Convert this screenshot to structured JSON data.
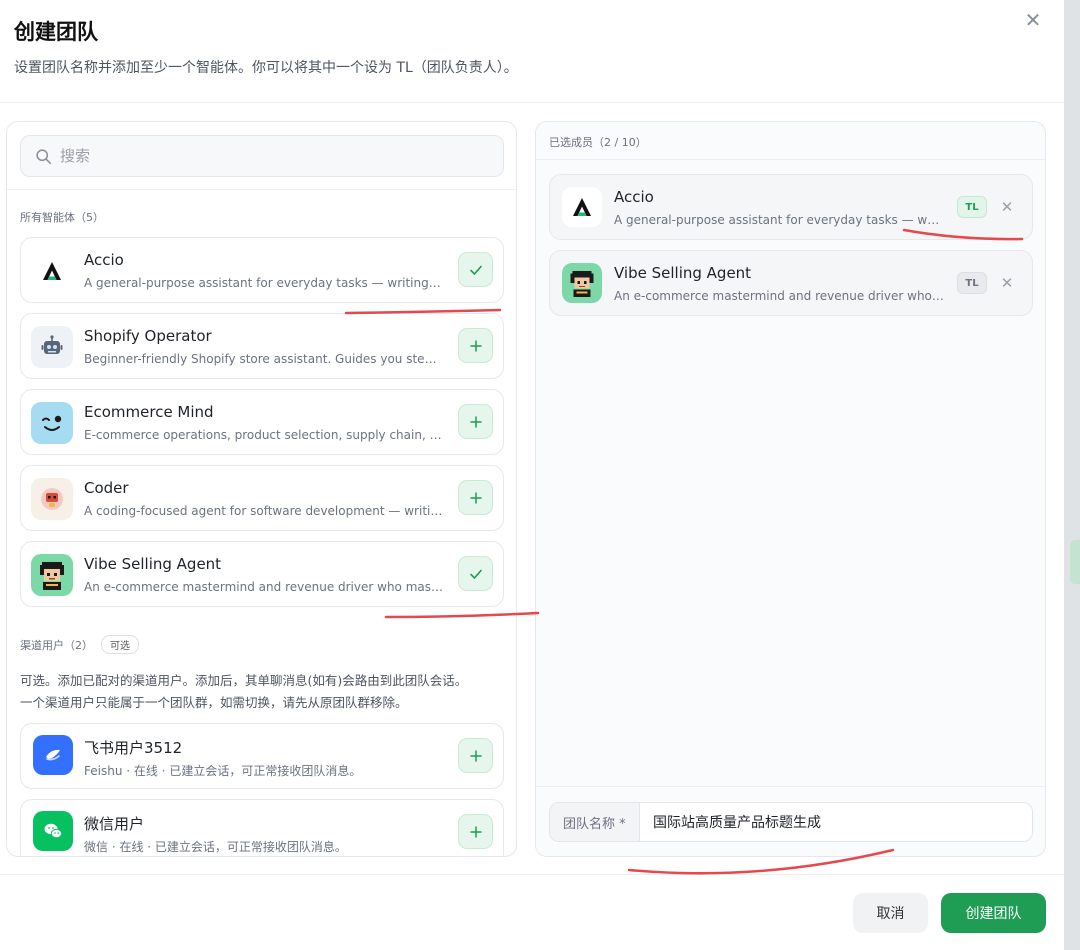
{
  "dialog": {
    "title": "创建团队",
    "subtitle": "设置团队名称并添加至少一个智能体。你可以将其中一个设为 TL（团队负责人）。"
  },
  "search": {
    "placeholder": "搜索",
    "value": ""
  },
  "agents_section": {
    "label": "所有智能体（5）",
    "items": [
      {
        "name": "Accio",
        "desc": "A general-purpose assistant for everyday tasks — writing, planning, research and more.",
        "icon": "accio-logo-icon",
        "selected": true
      },
      {
        "name": "Shopify Operator",
        "desc": "Beginner-friendly Shopify store assistant. Guides you step-by-step.",
        "icon": "robot-icon",
        "selected": false
      },
      {
        "name": "Ecommerce Mind",
        "desc": "E-commerce operations, product selection, supply chain, content.",
        "icon": "wink-face-icon",
        "selected": false
      },
      {
        "name": "Coder",
        "desc": "A coding-focused agent for software development — writing, debugging.",
        "icon": "coder-avatar-icon",
        "selected": false
      },
      {
        "name": "Vibe Selling Agent",
        "desc": "An e-commerce mastermind and revenue driver who masters selling.",
        "icon": "pixel-avatar-icon",
        "selected": true
      }
    ]
  },
  "channel_section": {
    "label": "渠道用户（2）",
    "chip": "可选",
    "desc_line1": "可选。添加已配对的渠道用户。添加后，其单聊消息(如有)会路由到此团队会话。",
    "desc_line2": "一个渠道用户只能属于一个团队群，如需切换，请先从原团队群移除。",
    "items": [
      {
        "name": "飞书用户3512",
        "desc": "Feishu · 在线 · 已建立会话，可正常接收团队消息。",
        "icon": "feishu-icon"
      },
      {
        "name": "微信用户",
        "desc": "微信 · 在线 · 已建立会话，可正常接收团队消息。",
        "icon": "wechat-icon"
      }
    ]
  },
  "members": {
    "label": "已选成员（2 / 10）",
    "items": [
      {
        "name": "Accio",
        "desc": "A general-purpose assistant for everyday tasks — writing, planning",
        "tl_label": "TL",
        "is_tl": true
      },
      {
        "name": "Vibe Selling Agent",
        "desc": "An e-commerce mastermind and revenue driver who masters selling",
        "tl_label": "TL",
        "is_tl": false
      }
    ]
  },
  "team_name": {
    "label": "团队名称 *",
    "value": "国际站高质量产品标题生成"
  },
  "footer": {
    "cancel_label": "取消",
    "create_label": "创建团队"
  },
  "colors": {
    "accent": "#1f9d55",
    "annotation": "#e5484d",
    "tl_active": "#1d9c5a"
  }
}
